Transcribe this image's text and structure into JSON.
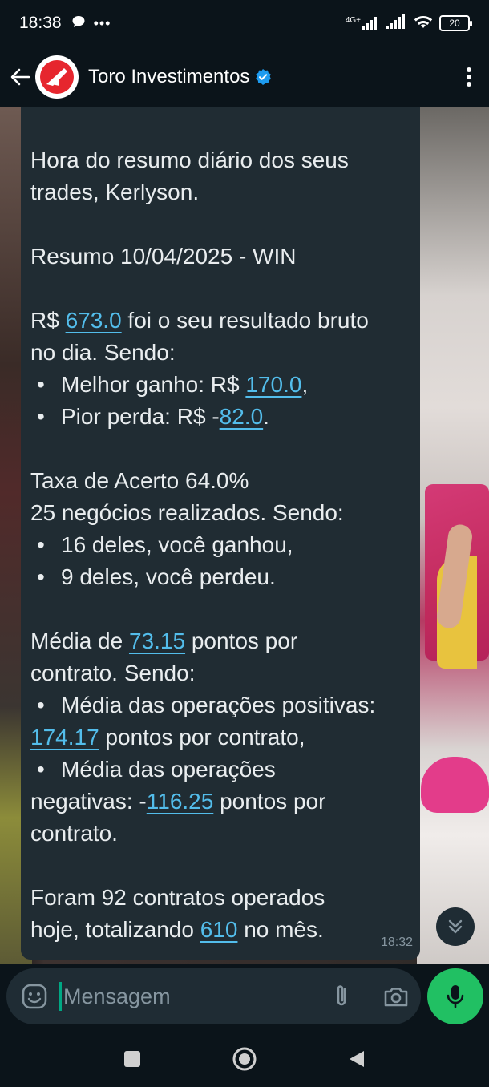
{
  "status_bar": {
    "time": "18:38",
    "network": "4G+",
    "battery": "20"
  },
  "header": {
    "contact_name": "Toro Investimentos"
  },
  "message": {
    "p1": [
      "Hora do resumo diário dos seus",
      "trades, Kerlyson."
    ],
    "p2": "Resumo 10/04/2025 - WIN",
    "p3": {
      "prefix": "R$ ",
      "value": "673.0",
      "suffix": " foi o seu resultado bruto",
      "line2": "no dia. Sendo:"
    },
    "best": {
      "label": "Melhor ganho: R$ ",
      "value": "170.0",
      "suffix": ","
    },
    "worst": {
      "label": "Pior perda: R$ -",
      "value": "82.0",
      "suffix": "."
    },
    "p4": [
      "Taxa de Acerto 64.0%",
      "25 negócios realizados. Sendo:"
    ],
    "won": "16 deles, você ganhou,",
    "lost": "9 deles, você perdeu.",
    "avg": {
      "prefix": "Média de ",
      "value": "73.15",
      "suffix": " pontos por",
      "line2": "contrato. Sendo:"
    },
    "avg_pos": {
      "label": "Média das operações positivas:",
      "value": "174.17",
      "suffix": " pontos por contrato,"
    },
    "avg_neg": {
      "label": "Média das operações",
      "prefix": "negativas: -",
      "value": "116.25",
      "suffix": " pontos por",
      "line3": "contrato."
    },
    "contracts": {
      "line1": "Foram 92 contratos operados",
      "prefix": "hoje, totalizando ",
      "value": "610",
      "suffix": " no mês."
    },
    "time": "18:32"
  },
  "input": {
    "placeholder": "Mensagem"
  }
}
